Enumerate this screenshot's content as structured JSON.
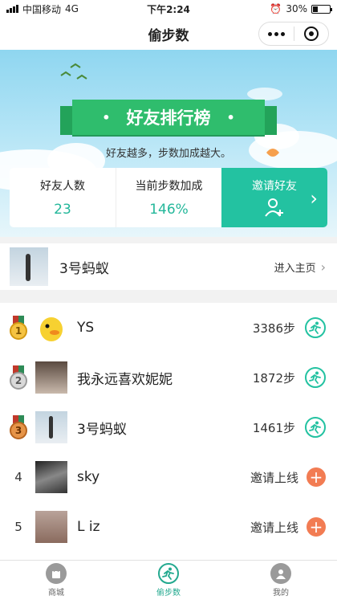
{
  "status_bar": {
    "carrier": "中国移动",
    "network": "4G",
    "time": "下午2:24",
    "battery": "30%",
    "battery_level": 0.3
  },
  "nav": {
    "title": "偷步数"
  },
  "banner": {
    "title": "好友排行榜",
    "tagline": "好友越多，步数加成越大。"
  },
  "stats": {
    "friends_label": "好友人数",
    "friends_value": "23",
    "bonus_label": "当前步数加成",
    "bonus_value": "146%",
    "invite_label": "邀请好友"
  },
  "me": {
    "name": "3号蚂蚁",
    "homepage_link": "进入主页"
  },
  "ranking": [
    {
      "rank": "1",
      "name": "YS",
      "steps": "3386步",
      "action": "run"
    },
    {
      "rank": "2",
      "name": "我永远喜欢妮妮",
      "steps": "1872步",
      "action": "run"
    },
    {
      "rank": "3",
      "name": "3号蚂蚁",
      "steps": "1461步",
      "action": "run"
    },
    {
      "rank": "4",
      "name": "sky",
      "invite": "邀请上线",
      "action": "invite"
    },
    {
      "rank": "5",
      "name": "L iz",
      "invite": "邀请上线",
      "action": "invite"
    }
  ],
  "tabs": [
    {
      "label": "商城"
    },
    {
      "label": "偷步数"
    },
    {
      "label": "我的"
    }
  ],
  "colors": {
    "accent": "#23c2a1",
    "ribbon": "#2fbd6d",
    "invite_orange": "#f27c53"
  }
}
